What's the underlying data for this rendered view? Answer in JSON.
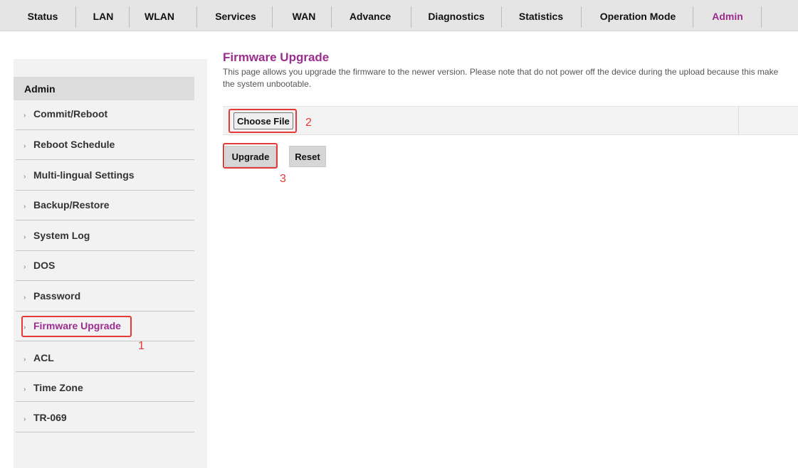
{
  "nav": {
    "tabs": [
      {
        "label": "Status"
      },
      {
        "label": "LAN"
      },
      {
        "label": "WLAN"
      },
      {
        "label": "Services"
      },
      {
        "label": "WAN"
      },
      {
        "label": "Advance"
      },
      {
        "label": "Diagnostics"
      },
      {
        "label": "Statistics"
      },
      {
        "label": "Operation Mode"
      },
      {
        "label": "Admin"
      }
    ],
    "active_index": 9,
    "active_color": "#9b2d8e"
  },
  "sidebar": {
    "header": "Admin",
    "arrow_glyph": "›",
    "items": [
      {
        "label": "Commit/Reboot"
      },
      {
        "label": "Reboot Schedule"
      },
      {
        "label": "Multi-lingual Settings"
      },
      {
        "label": "Backup/Restore"
      },
      {
        "label": "System Log"
      },
      {
        "label": "DOS"
      },
      {
        "label": "Password"
      },
      {
        "label": "Firmware Upgrade"
      },
      {
        "label": "ACL"
      },
      {
        "label": "Time Zone"
      },
      {
        "label": "TR-069"
      }
    ],
    "active_index": 7
  },
  "main": {
    "title": "Firmware Upgrade",
    "description": "This page allows you upgrade the firmware to the newer version. Please note that do not power off the device during the upload because this make the system unbootable.",
    "choose_file_label": "Choose File",
    "upgrade_label": "Upgrade",
    "reset_label": "Reset"
  },
  "annotations": {
    "marker_1": "1",
    "marker_2": "2",
    "marker_3": "3",
    "color": "#e53935"
  }
}
